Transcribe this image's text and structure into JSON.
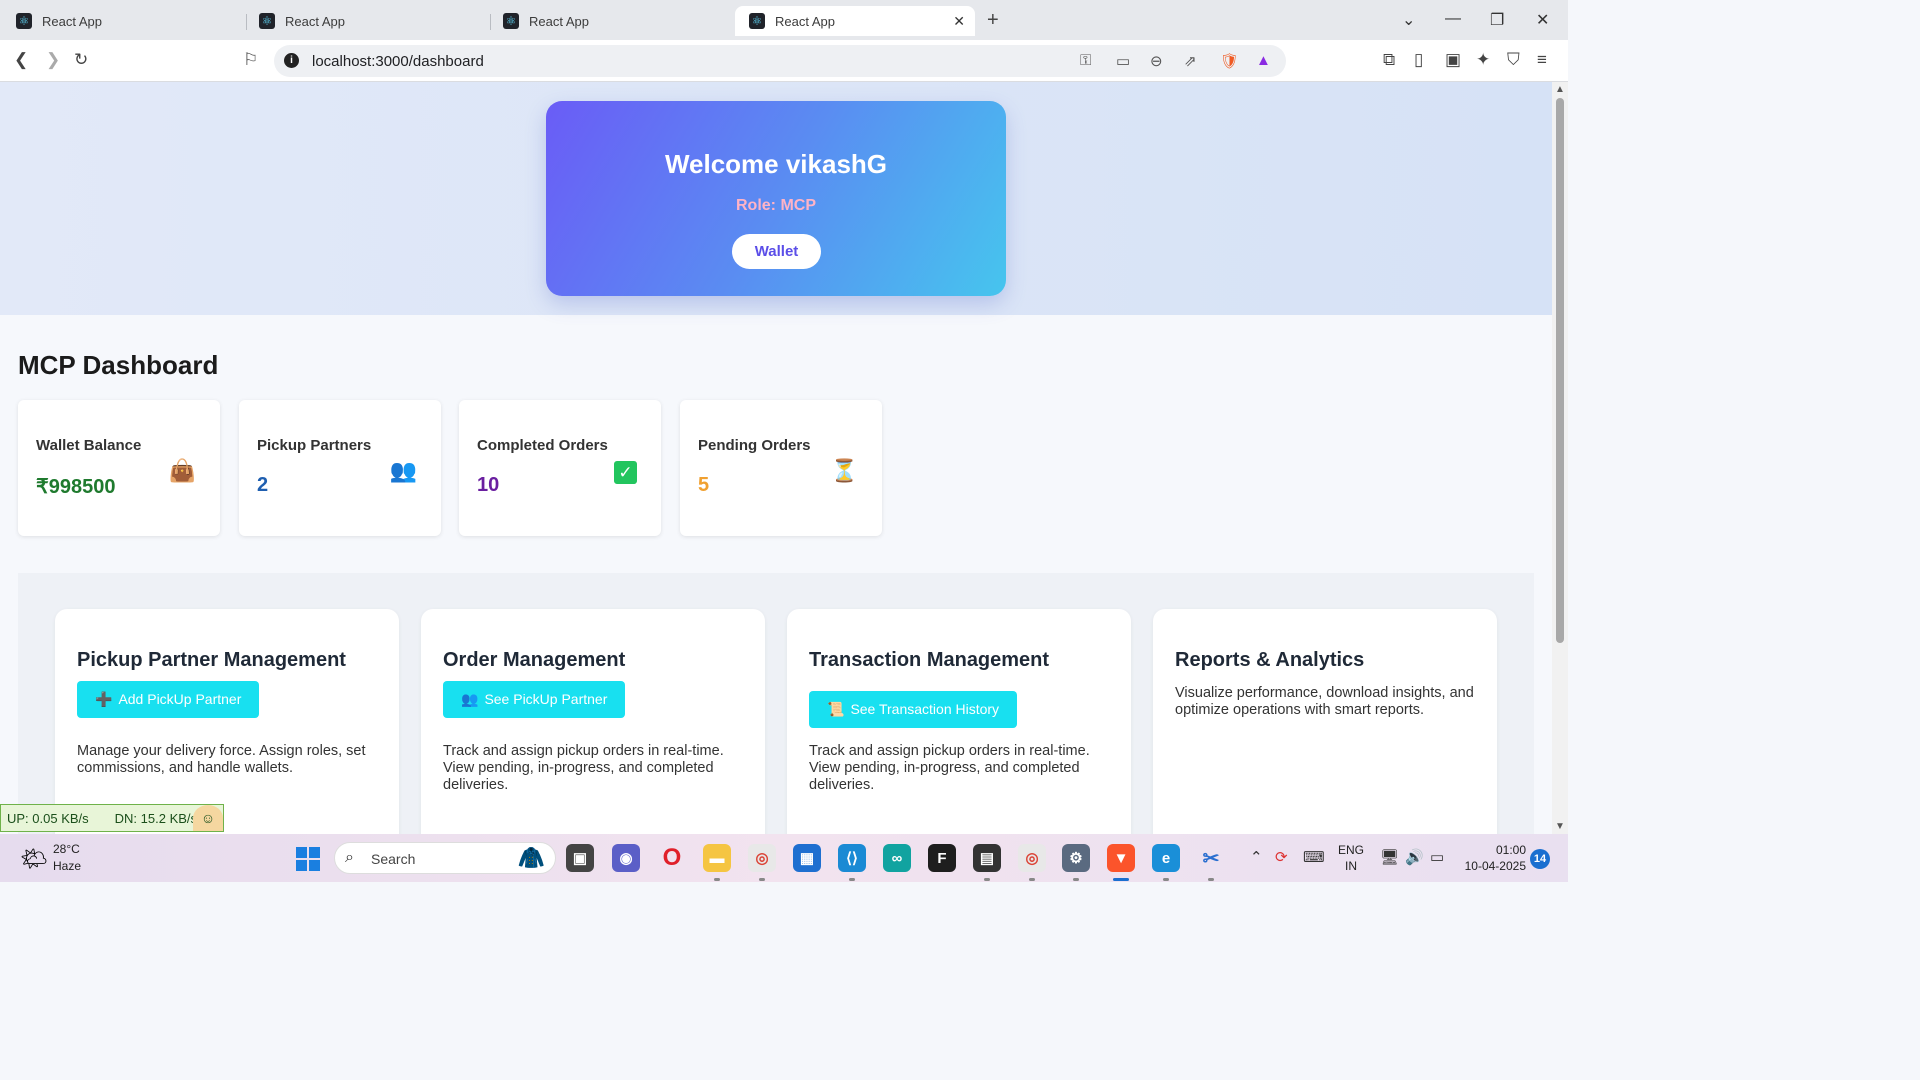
{
  "browser": {
    "tabs": [
      {
        "title": "React App"
      },
      {
        "title": "React App"
      },
      {
        "title": "React App"
      },
      {
        "title": "React App"
      }
    ],
    "url": "localhost:3000/dashboard"
  },
  "hero": {
    "welcome": "Welcome vikashG",
    "role": "Role: MCP",
    "wallet_button": "Wallet"
  },
  "dashboard": {
    "title": "MCP Dashboard",
    "stats": [
      {
        "label": "Wallet Balance",
        "value": "₹998500",
        "color": "#1f7a2e",
        "icon": "money-bag-icon"
      },
      {
        "label": "Pickup Partners",
        "value": "2",
        "color": "#1f5fb0",
        "icon": "people-icon"
      },
      {
        "label": "Completed Orders",
        "value": "10",
        "color": "#6a1fa0",
        "icon": "check-mark-icon"
      },
      {
        "label": "Pending Orders",
        "value": "5",
        "color": "#f0a030",
        "icon": "hourglass-icon"
      }
    ]
  },
  "management": [
    {
      "title": "Pickup Partner Management",
      "button": "Add PickUp Partner",
      "description": "Manage your delivery force. Assign roles, set commissions, and handle wallets."
    },
    {
      "title": "Order Management",
      "button": "See PickUp Partner",
      "description": "Track and assign pickup orders in real-time. View pending, in-progress, and completed deliveries."
    },
    {
      "title": "Transaction Management",
      "button": "See Transaction History",
      "description": "Track and assign pickup orders in real-time. View pending, in-progress, and completed deliveries."
    },
    {
      "title": "Reports & Analytics",
      "description": "Visualize performance, download insights, and optimize operations with smart reports."
    }
  ],
  "netmonitor": {
    "up": "UP: 0.05 KB/s",
    "down": "DN: 15.2 KB/s"
  },
  "taskbar": {
    "temperature": "28°C",
    "weather": "Haze",
    "search_placeholder": "Search",
    "lang_line1": "ENG",
    "lang_line2": "IN",
    "time": "01:00",
    "date": "10-04-2025",
    "notifications": "14"
  },
  "colors": {
    "accent": "#18e0f0",
    "brand_gradient_start": "#6a5cf6",
    "brand_gradient_end": "#46c5ee"
  }
}
